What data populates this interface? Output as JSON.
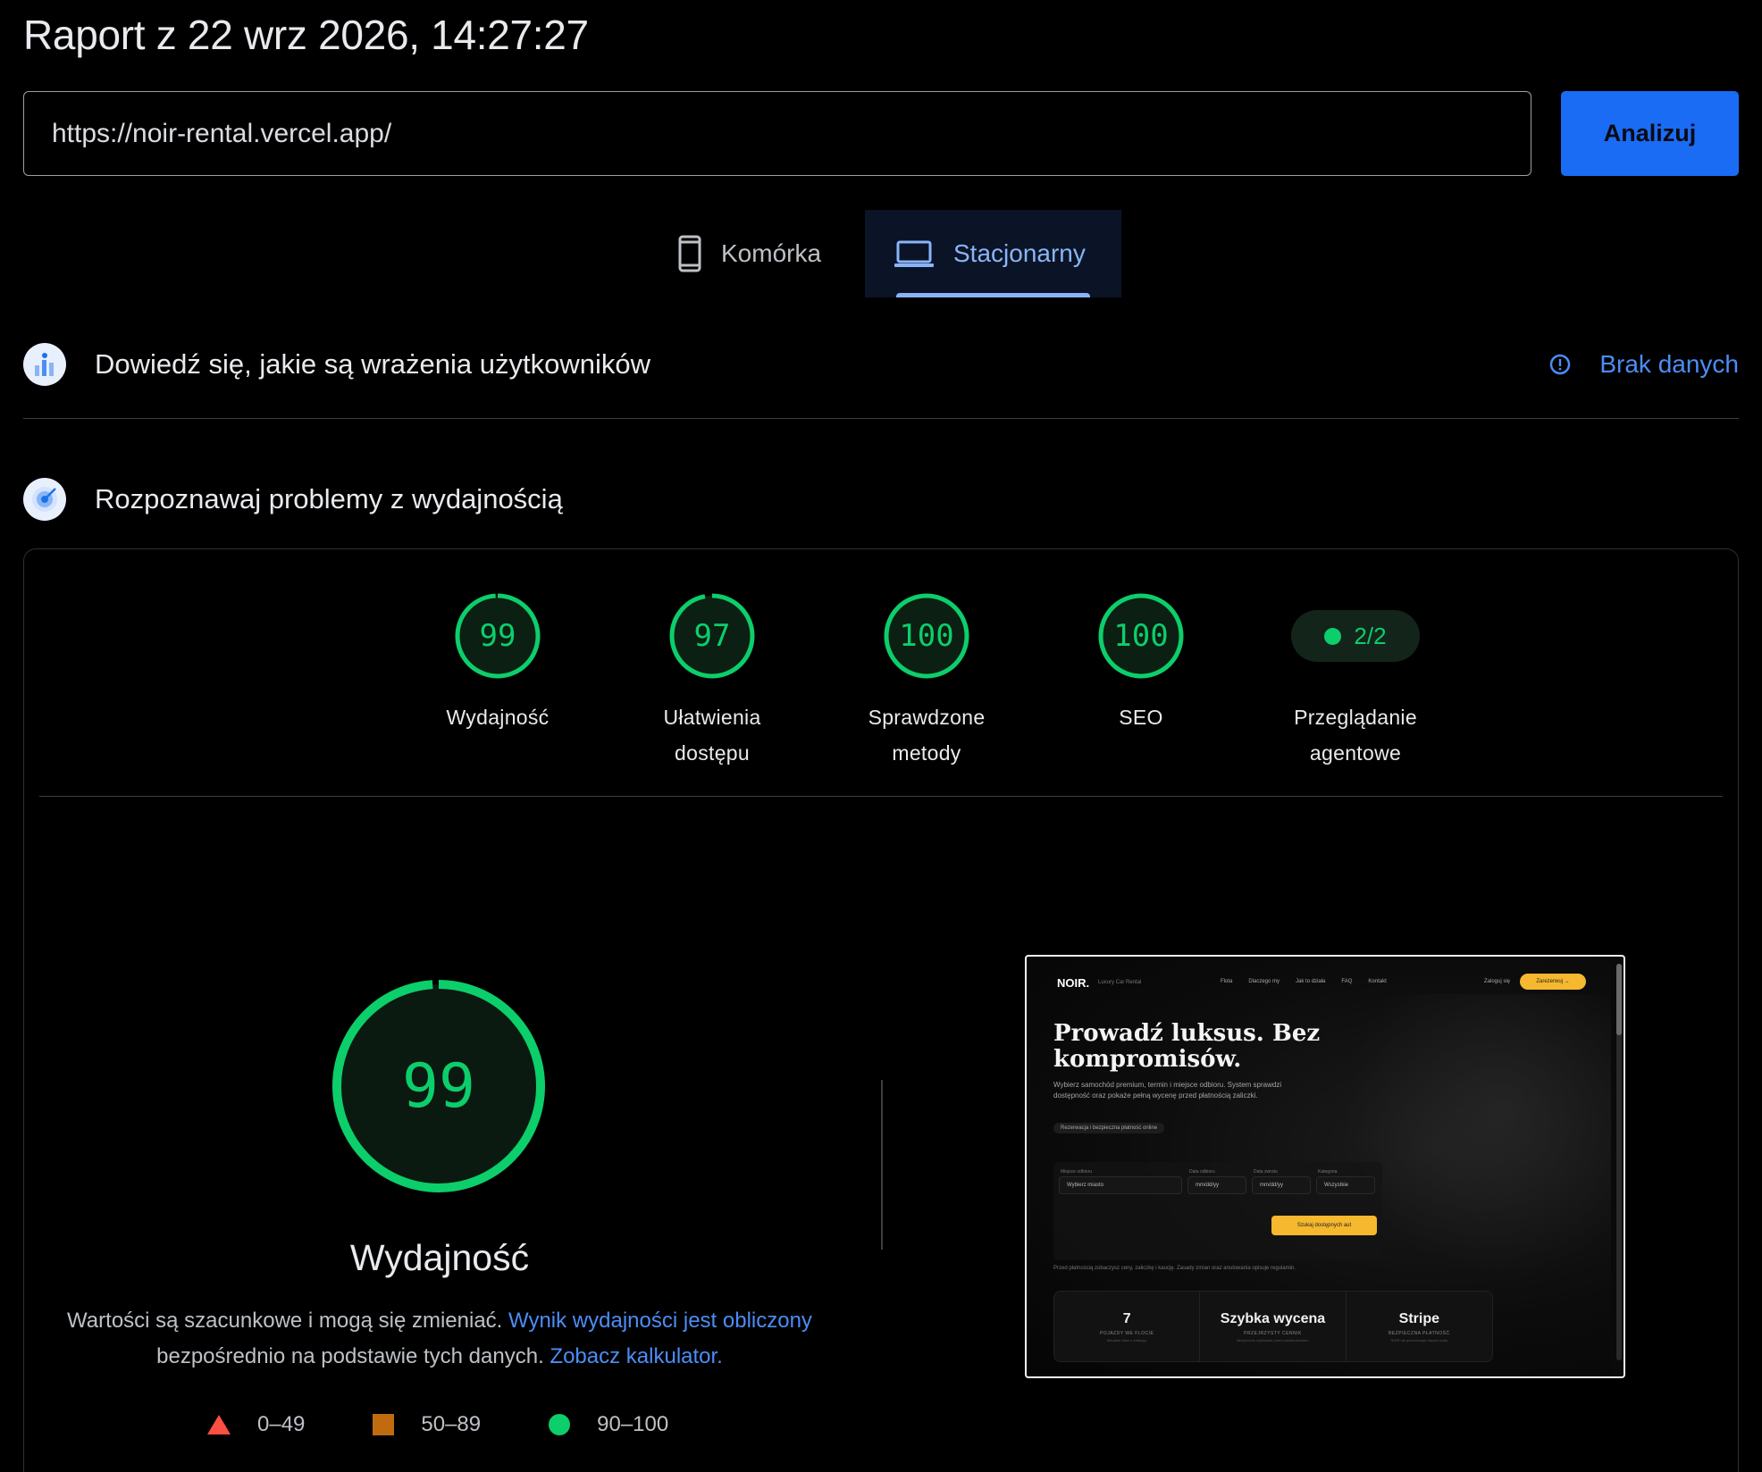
{
  "report": {
    "title": "Raport z 22 wrz 2026, 14:27:27"
  },
  "search": {
    "url": "https://noir-rental.vercel.app/",
    "analyze_label": "Analizuj"
  },
  "tabs": [
    {
      "label": "Komórka",
      "icon": "phone-icon",
      "selected": false
    },
    {
      "label": "Stacjonarny",
      "icon": "laptop-icon",
      "selected": true
    }
  ],
  "crux": {
    "title": "Dowiedź się, jakie są wrażenia użytkowników",
    "status": "Brak danych",
    "icon": "crux-icon"
  },
  "lighthouse": {
    "title": "Rozpoznawaj problemy z wydajnością",
    "icon": "lighthouse-icon"
  },
  "scores": [
    {
      "value": "99",
      "score": 99,
      "label": "Wydajność"
    },
    {
      "value": "97",
      "score": 97,
      "label": "Ułatwienia dostępu"
    },
    {
      "value": "100",
      "score": 100,
      "label": "Sprawdzone metody"
    },
    {
      "value": "100",
      "score": 100,
      "label": "SEO"
    }
  ],
  "agentic": {
    "value": "2/2",
    "label": "Przeglądanie agentowe"
  },
  "performance": {
    "score": "99",
    "score_fraction": 0.99,
    "label": "Wydajność",
    "desc_part1": "Wartości są szacunkowe i mogą się zmieniać. ",
    "desc_link1": "Wynik wydajności jest obliczony",
    "desc_part2": " bezpośrednio na podstawie tych danych. ",
    "desc_link2": "Zobacz kalkulator."
  },
  "legend": [
    {
      "range": "0–49",
      "shape": "triangle",
      "color": "#ff4e42"
    },
    {
      "range": "50–89",
      "shape": "square",
      "color": "#c06b10"
    },
    {
      "range": "90–100",
      "shape": "circle",
      "color": "#0cce6b"
    }
  ],
  "colors": {
    "pass": "#0cce6b",
    "accent": "#1a6cf4",
    "link": "#4c8df6",
    "tab_selected": "#8ab4f8"
  },
  "preview": {
    "logo": "NOIR.",
    "logo_sub": "Luxury Car Rental",
    "nav": [
      "Flota",
      "Dlaczego my",
      "Jak to działa",
      "FAQ",
      "Kontakt"
    ],
    "login": "Zaloguj się",
    "reserve": "Zarezerwuj →",
    "hero": "Prowadź luksus. Bez kompromisów.",
    "sub": "Wybierz samochód premium, termin i miejsce odbioru. System sprawdzi dostępność oraz pokaże pełną wycenę przed płatnością zaliczki.",
    "chip": "Rezerwacja i bezpieczna płatność online",
    "fields": [
      {
        "label": "Miejsce odbioru",
        "value": "Wybierz miasto"
      },
      {
        "label": "Data odbioru",
        "value": "mm/dd/yy"
      },
      {
        "label": "Data zwrotu",
        "value": "mm/dd/yy"
      },
      {
        "label": "Kategoria",
        "value": "Wszystkie"
      }
    ],
    "search": "Szukaj dostępnych aut",
    "note": "Przed płatnością zobaczysz ceny, zaliczkę i kaucję. Zasady zmian oraz anulowania opisuje regulamin.",
    "stats": [
      {
        "value": "7",
        "label": "POJAZDY WE FLOCIE",
        "desc": "Aktualne dane z katalogu"
      },
      {
        "value": "Szybka wycena",
        "label": "PRZEJRZYSTY CENNIK",
        "desc": "Bezpieczne wyliczanie przed potwierdzeniem"
      },
      {
        "value": "Stripe",
        "label": "BEZPIECZNA PŁATNOŚĆ",
        "desc": "NOIR nie przechowuje danych karty"
      }
    ]
  }
}
